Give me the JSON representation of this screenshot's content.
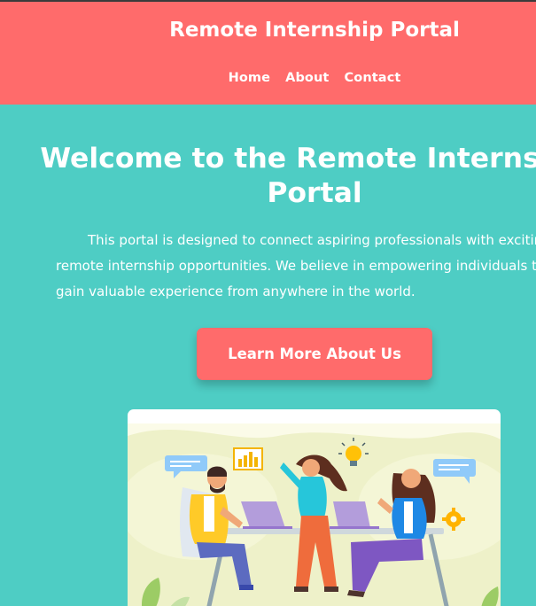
{
  "header": {
    "title": "Remote Internship Portal",
    "nav": [
      {
        "label": "Home"
      },
      {
        "label": "About"
      },
      {
        "label": "Contact"
      }
    ]
  },
  "hero": {
    "title": "Welcome to the Remote Internship Portal",
    "description": "This portal is designed to connect aspiring professionals with exciting remote internship opportunities. We believe in empowering individuals to gain valuable experience from anywhere in the world.",
    "cta_label": "Learn More About Us"
  },
  "illustration": {
    "icons": [
      "chat-bubble-icon",
      "bar-chart-icon",
      "lightbulb-icon",
      "gear-icon",
      "laptop-icon"
    ]
  },
  "colors": {
    "header_bg": "#ff6b6b",
    "page_bg": "#4ecdc4",
    "button_bg": "#ff6b6b",
    "text": "#ffffff"
  }
}
